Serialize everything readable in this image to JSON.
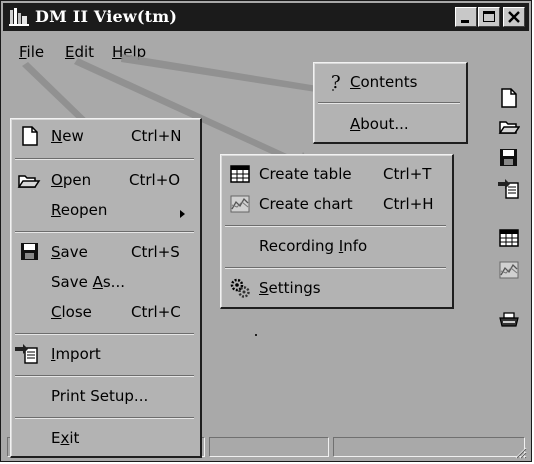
{
  "app": {
    "title": "DM II View(tm)"
  },
  "window_controls": {
    "minimize_icon": "minimize-icon",
    "maximize_icon": "maximize-icon",
    "close_icon": "close-icon"
  },
  "menubar": {
    "file": {
      "pre": "",
      "acc": "F",
      "post": "ile"
    },
    "edit": {
      "pre": "",
      "acc": "E",
      "post": "dit"
    },
    "help": {
      "pre": "",
      "acc": "H",
      "post": "elp"
    }
  },
  "file_menu": {
    "new": {
      "acc": "N",
      "post": "ew",
      "shortcut": "Ctrl+N",
      "icon": "new-document-icon"
    },
    "open": {
      "acc": "O",
      "post": "pen",
      "shortcut": "Ctrl+O",
      "icon": "open-folder-icon"
    },
    "reopen": {
      "acc": "R",
      "post": "eopen",
      "submenu_icon": "submenu-arrow-icon"
    },
    "save": {
      "acc": "S",
      "post": "ave",
      "shortcut": "Ctrl+S",
      "icon": "save-disk-icon"
    },
    "save_as": {
      "pre": "Save ",
      "acc": "A",
      "post": "s..."
    },
    "close": {
      "acc": "C",
      "post": "lose",
      "shortcut": "Ctrl+C"
    },
    "import": {
      "acc": "I",
      "post": "mport",
      "icon": "import-icon"
    },
    "print_setup": {
      "label": "Print Setup..."
    },
    "exit": {
      "pre": "E",
      "acc": "x",
      "post": "it"
    }
  },
  "edit_menu": {
    "create_table": {
      "label": "Create table",
      "shortcut": "Ctrl+T",
      "icon": "table-icon"
    },
    "create_chart": {
      "label": "Create chart",
      "shortcut": "Ctrl+H",
      "icon": "chart-icon"
    },
    "recording_info": {
      "pre": "Recording ",
      "acc": "I",
      "post": "nfo"
    },
    "settings": {
      "acc": "S",
      "post": "ettings",
      "icon": "settings-icon"
    }
  },
  "help_menu": {
    "contents": {
      "acc": "C",
      "post": "ontents",
      "icon": "help-question-icon"
    },
    "about": {
      "acc": "A",
      "post": "bout..."
    }
  },
  "toolbar": {
    "buttons": [
      "new-document-icon",
      "open-folder-icon",
      "save-disk-icon",
      "import-icon",
      "table-icon",
      "chart-icon",
      "print-icon"
    ]
  },
  "colors": {
    "titlebar": "#1b1b1b",
    "window_bg": "#a9a9a9",
    "menu_bg": "#b3b3b3",
    "arrow": "#8e8e8e"
  }
}
